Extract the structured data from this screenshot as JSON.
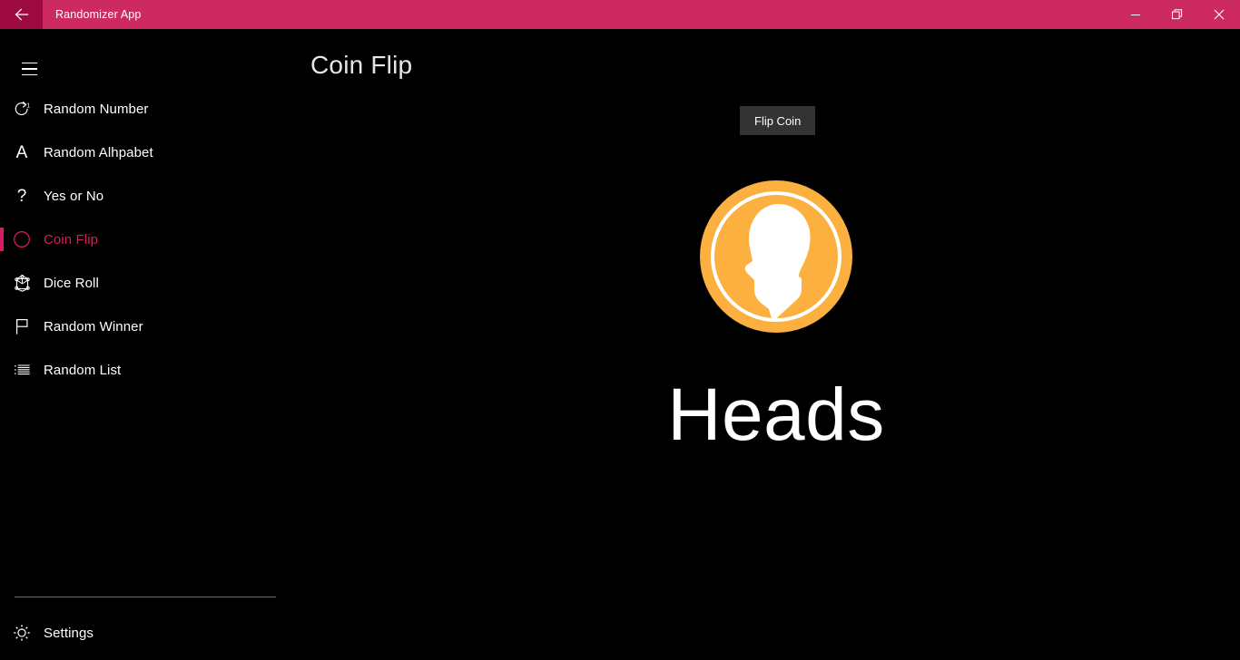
{
  "window": {
    "title": "Randomizer App",
    "back_icon": "back-arrow-icon",
    "controls": {
      "minimize": "minimize-icon",
      "restore": "restore-icon",
      "close": "close-icon"
    }
  },
  "colors": {
    "titlebar": "#cd2a61",
    "back_button": "#9c0a3f",
    "accent": "#d51b63",
    "coin": "#fbb040",
    "button": "#333333",
    "background": "#000000"
  },
  "sidebar": {
    "menu_icon": "hamburger-icon",
    "items": [
      {
        "label": "Random Number",
        "icon": "refresh-one-icon",
        "active": false
      },
      {
        "label": "Random Alhpabet",
        "icon": "letter-a-icon",
        "active": false
      },
      {
        "label": "Yes or No",
        "icon": "question-mark-icon",
        "active": false
      },
      {
        "label": "Coin Flip",
        "icon": "circle-icon",
        "active": true
      },
      {
        "label": "Dice Roll",
        "icon": "dice-cube-icon",
        "active": false
      },
      {
        "label": "Random Winner",
        "icon": "flag-icon",
        "active": false
      },
      {
        "label": "Random List",
        "icon": "list-icon",
        "active": false
      }
    ],
    "settings": {
      "label": "Settings",
      "icon": "gear-icon"
    }
  },
  "main": {
    "title": "Coin Flip",
    "flip_button": "Flip Coin",
    "coin_icon": "coin-heads-icon",
    "result": "Heads"
  }
}
